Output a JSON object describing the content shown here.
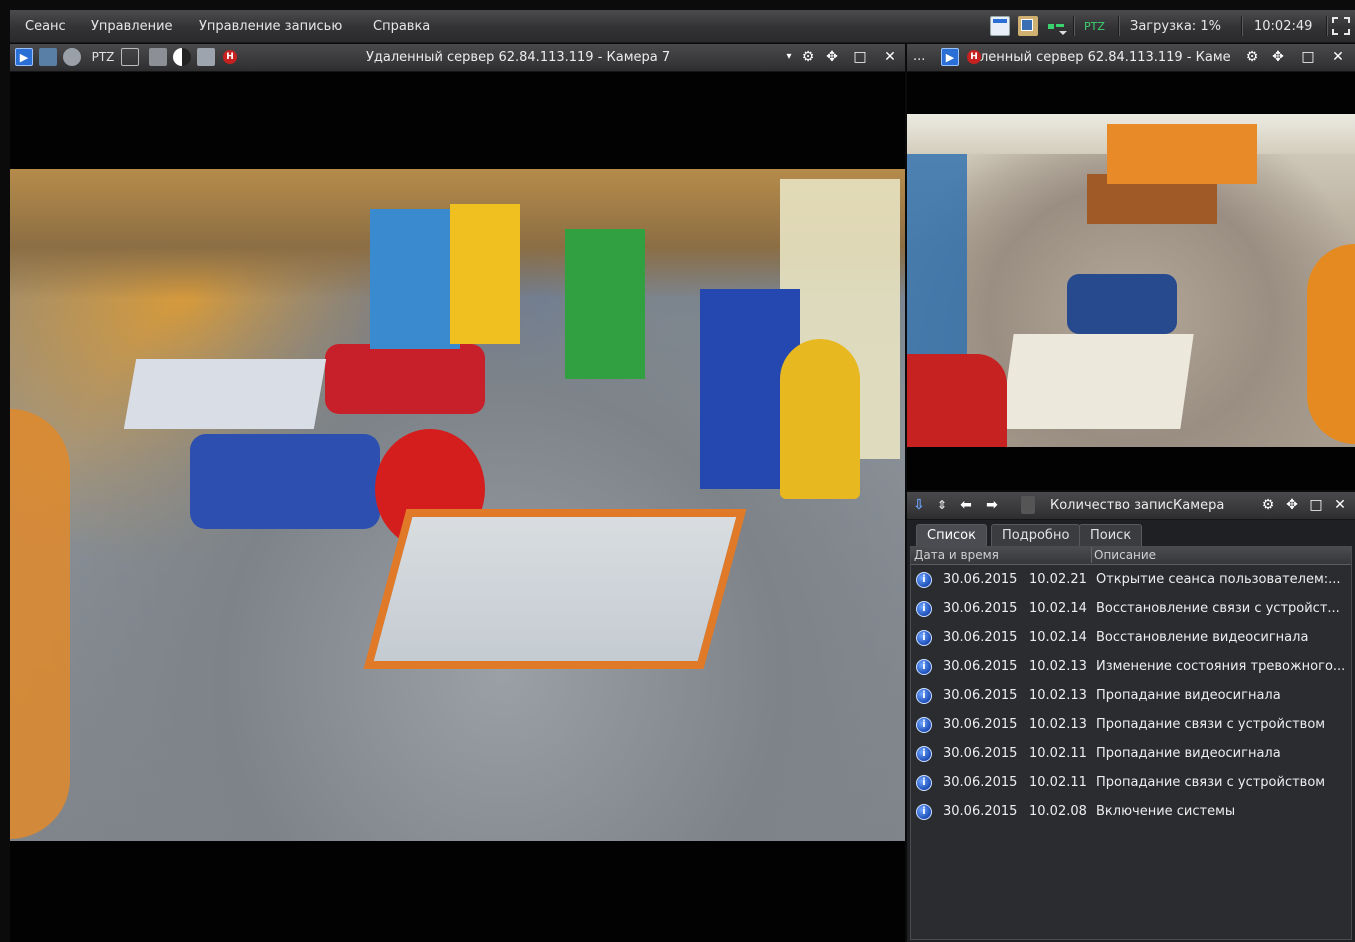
{
  "menu": {
    "items": [
      "Сеанс",
      "Управление",
      "Управление записью",
      "Справка"
    ]
  },
  "status": {
    "ptz_label": "PTZ",
    "load": "Загрузка: 1%",
    "clock": "10:02:49"
  },
  "camera_main": {
    "ptz_label": "PTZ",
    "title": "Удаленный сервер 62.84.113.119 - Камера 7"
  },
  "camera_side": {
    "more_label": "...",
    "title": "ленный сервер 62.84.113.119 - Каме"
  },
  "events": {
    "title": "Количество записКамера",
    "tabs": [
      "Список",
      "Подробно",
      "Поиск"
    ],
    "columns": [
      "Дата и время",
      "Описание"
    ],
    "rows": [
      {
        "date": "30.06.2015",
        "time": "10.02.21",
        "desc": "Открытие сеанса пользователем:..."
      },
      {
        "date": "30.06.2015",
        "time": "10.02.14",
        "desc": "Восстановление связи с устройст..."
      },
      {
        "date": "30.06.2015",
        "time": "10.02.14",
        "desc": "Восстановление видеосигнала"
      },
      {
        "date": "30.06.2015",
        "time": "10.02.13",
        "desc": "Изменение состояния тревожного..."
      },
      {
        "date": "30.06.2015",
        "time": "10.02.13",
        "desc": "Пропадание видеосигнала"
      },
      {
        "date": "30.06.2015",
        "time": "10.02.13",
        "desc": "Пропадание связи с устройством"
      },
      {
        "date": "30.06.2015",
        "time": "10.02.11",
        "desc": "Пропадание видеосигнала"
      },
      {
        "date": "30.06.2015",
        "time": "10.02.11",
        "desc": "Пропадание связи с устройством"
      },
      {
        "date": "30.06.2015",
        "time": "10.02.08",
        "desc": "Включение системы"
      }
    ]
  },
  "colors": {
    "accent_blue": "#2a6fd6",
    "record_red": "#c62222",
    "ptz_green": "#3bd16f"
  }
}
